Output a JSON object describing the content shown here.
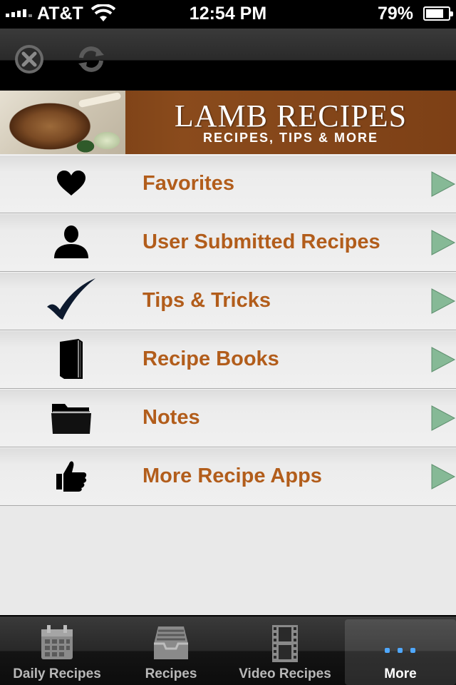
{
  "status_bar": {
    "carrier": "AT&T",
    "time": "12:54 PM",
    "battery": "79%",
    "battery_level": 0.79
  },
  "toolbar": {
    "close_icon": "close-icon",
    "refresh_icon": "refresh-icon"
  },
  "banner": {
    "title": "LAMB RECIPES",
    "subtitle": "RECIPES, TIPS & MORE"
  },
  "menu": {
    "items": [
      {
        "label": "Favorites",
        "icon": "heart-icon"
      },
      {
        "label": "User Submitted Recipes",
        "icon": "user-icon"
      },
      {
        "label": "Tips & Tricks",
        "icon": "checkmark-icon"
      },
      {
        "label": "Recipe Books",
        "icon": "book-icon"
      },
      {
        "label": "Notes",
        "icon": "folder-icon"
      },
      {
        "label": "More Recipe Apps",
        "icon": "thumbs-up-icon"
      }
    ],
    "label_color": "#b25d1b",
    "arrow_color": "#7fb08a"
  },
  "tab_bar": {
    "tabs": [
      {
        "label": "Daily Recipes",
        "icon": "calendar-icon"
      },
      {
        "label": "Recipes",
        "icon": "inbox-tray-icon"
      },
      {
        "label": "Video Recipes",
        "icon": "film-strip-icon"
      },
      {
        "label": "More",
        "icon": "more-dots-icon",
        "active": true
      }
    ]
  }
}
